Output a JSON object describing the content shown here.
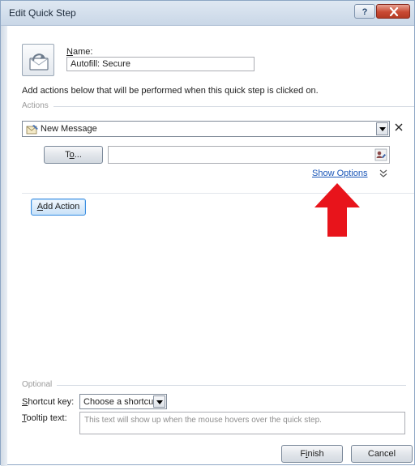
{
  "window": {
    "title": "Edit Quick Step",
    "help_label": "?"
  },
  "quickstep": {
    "name_label_accel": "N",
    "name_label_rest": "ame:",
    "name_value": "Autofill: Secure",
    "instructions": "Add actions below that will be performed when this quick step is clicked on."
  },
  "actions": {
    "group_label": "Actions",
    "action_value": "New Message",
    "to_button_pre": "T",
    "to_button_accel": "o",
    "to_button_post": "...",
    "to_value": "",
    "show_options_pre": "Show ",
    "show_options_accel": "O",
    "show_options_post": "ptions",
    "add_action_accel": "A",
    "add_action_rest": "dd Action"
  },
  "optional": {
    "group_label": "Optional",
    "shortcut_label_accel": "S",
    "shortcut_label_rest": "hortcut key:",
    "shortcut_value": "Choose a shortcut",
    "tooltip_label_accel": "T",
    "tooltip_label_rest": "ooltip text:",
    "tooltip_placeholder": "This text will show up when the mouse hovers over the quick step."
  },
  "footer": {
    "finish_pre": "F",
    "finish_accel": "i",
    "finish_post": "nish",
    "cancel_label": "Cancel"
  },
  "colors": {
    "link": "#1a56b8",
    "annotation_arrow": "#e8141b",
    "focus_border": "#3d8ee0"
  },
  "icons": {
    "quickstep": "quickstep-arrow-icon",
    "message": "new-message-icon",
    "address_book": "address-book-icon",
    "remove": "close-icon",
    "expand": "double-chevron-down-icon",
    "annotation": "red-arrow-up-icon"
  }
}
